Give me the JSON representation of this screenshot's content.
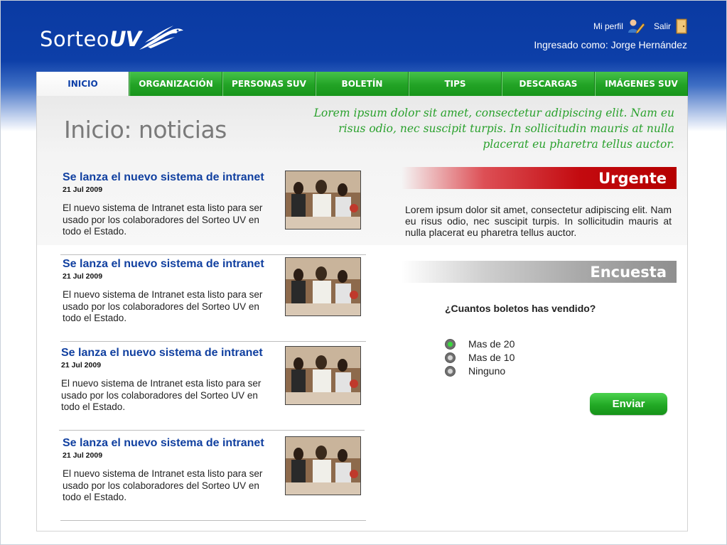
{
  "brand": {
    "logo_text_left": "Sorteo",
    "logo_text_right": "UV"
  },
  "header": {
    "profile_label": "Mi perfil",
    "profile_icon": "user-edit-icon",
    "logout_label": "Salir",
    "logout_icon": "door-icon",
    "logged_in_as": "Ingresado como: Jorge Hernández"
  },
  "nav": {
    "items": [
      {
        "label": "INICIO",
        "active": true
      },
      {
        "label": "ORGANIZACIÓN"
      },
      {
        "label": "PERSONAS SUV"
      },
      {
        "label": "BOLETÍN"
      },
      {
        "label": "TIPS"
      },
      {
        "label": "DESCARGAS"
      },
      {
        "label": "IMÁGENES SUV"
      }
    ]
  },
  "page": {
    "title": "Inicio: noticias",
    "intro": "Lorem ipsum dolor sit amet, consectetur adipiscing elit. Nam eu risus odio, nec suscipit turpis. In sollicitudin mauris at nulla placerat eu pharetra tellus auctor."
  },
  "news": [
    {
      "title": "Se lanza el nuevo sistema de intranet",
      "date": "21 Jul 2009",
      "body": "El nuevo sistema de Intranet esta listo para ser usado por los colaboradores del Sorteo UV en todo el Estado."
    },
    {
      "title": "Se lanza el nuevo sistema de intranet",
      "date": "21 Jul 2009",
      "body": "El nuevo sistema de Intranet esta listo para ser usado por los colaboradores del Sorteo UV en todo el Estado."
    },
    {
      "title": "Se lanza el nuevo sistema de intranet",
      "date": "21 Jul 2009",
      "body": "El nuevo sistema de Intranet esta listo para ser usado por los colaboradores del Sorteo UV en todo el Estado."
    },
    {
      "title": "Se lanza el nuevo sistema de intranet",
      "date": "21 Jul 2009",
      "body": "El nuevo sistema de Intranet esta listo para ser usado por los colaboradores del Sorteo UV en todo el Estado."
    }
  ],
  "urgent": {
    "title": "Urgente",
    "text": "Lorem ipsum dolor sit amet, consectetur adipiscing elit. Nam eu risus odio, nec suscipit turpis. In sollicitudin mauris at nulla placerat eu pharetra tellus auctor."
  },
  "poll": {
    "title": "Encuesta",
    "question": "¿Cuantos boletos has vendido?",
    "options": [
      {
        "label": "Mas de 20",
        "selected": true
      },
      {
        "label": "Mas de 10",
        "selected": false
      },
      {
        "label": "Ninguno",
        "selected": false
      }
    ],
    "submit_label": "Enviar"
  },
  "colors": {
    "header_blue": "#0d3fa8",
    "nav_green": "#22a325",
    "urgent_red": "#c30a0f",
    "intro_green": "#2aa12d"
  }
}
